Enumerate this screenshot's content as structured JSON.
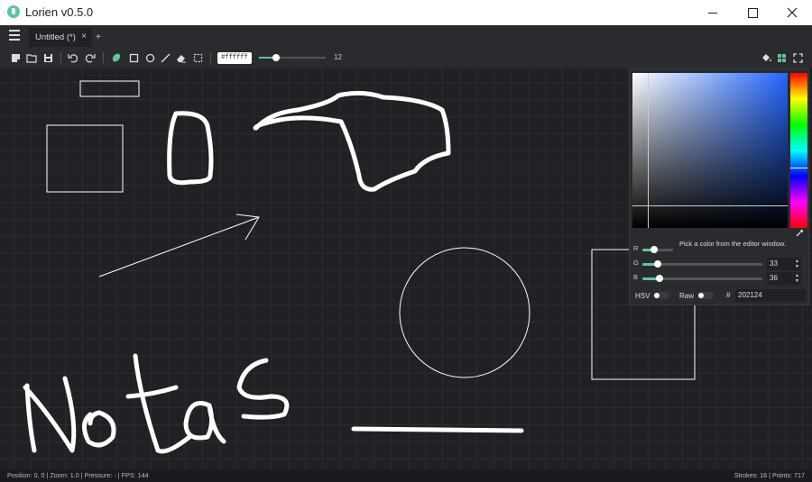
{
  "window": {
    "title": "Lorien v0.5.0"
  },
  "tabs": [
    {
      "label": "Untitled (*)",
      "close": "×"
    }
  ],
  "tab_add": "+",
  "toolbar": {
    "color_hex": "#ffffff",
    "brush_size": "12",
    "brush_size_fraction": 0.25
  },
  "status": {
    "left": "Position: 0, 0 | Zoom: 1.0 | Pressure: - | FPS: 144",
    "right": "Strokes: 16 | Points: 717"
  },
  "picker": {
    "hint": "Pick a color from the editor window.",
    "r_label": "R",
    "g_label": "G",
    "b_label": "B",
    "g_value": "33",
    "b_value": "36",
    "r_fraction": 0.13,
    "g_fraction": 0.13,
    "b_fraction": 0.14,
    "hsv_label": "HSV",
    "raw_label": "Raw",
    "hash": "#",
    "hex": "202124"
  },
  "colors": {
    "accent": "#5cc5a0",
    "canvas_bg": "#202124",
    "panel": "#2a2b2e"
  }
}
